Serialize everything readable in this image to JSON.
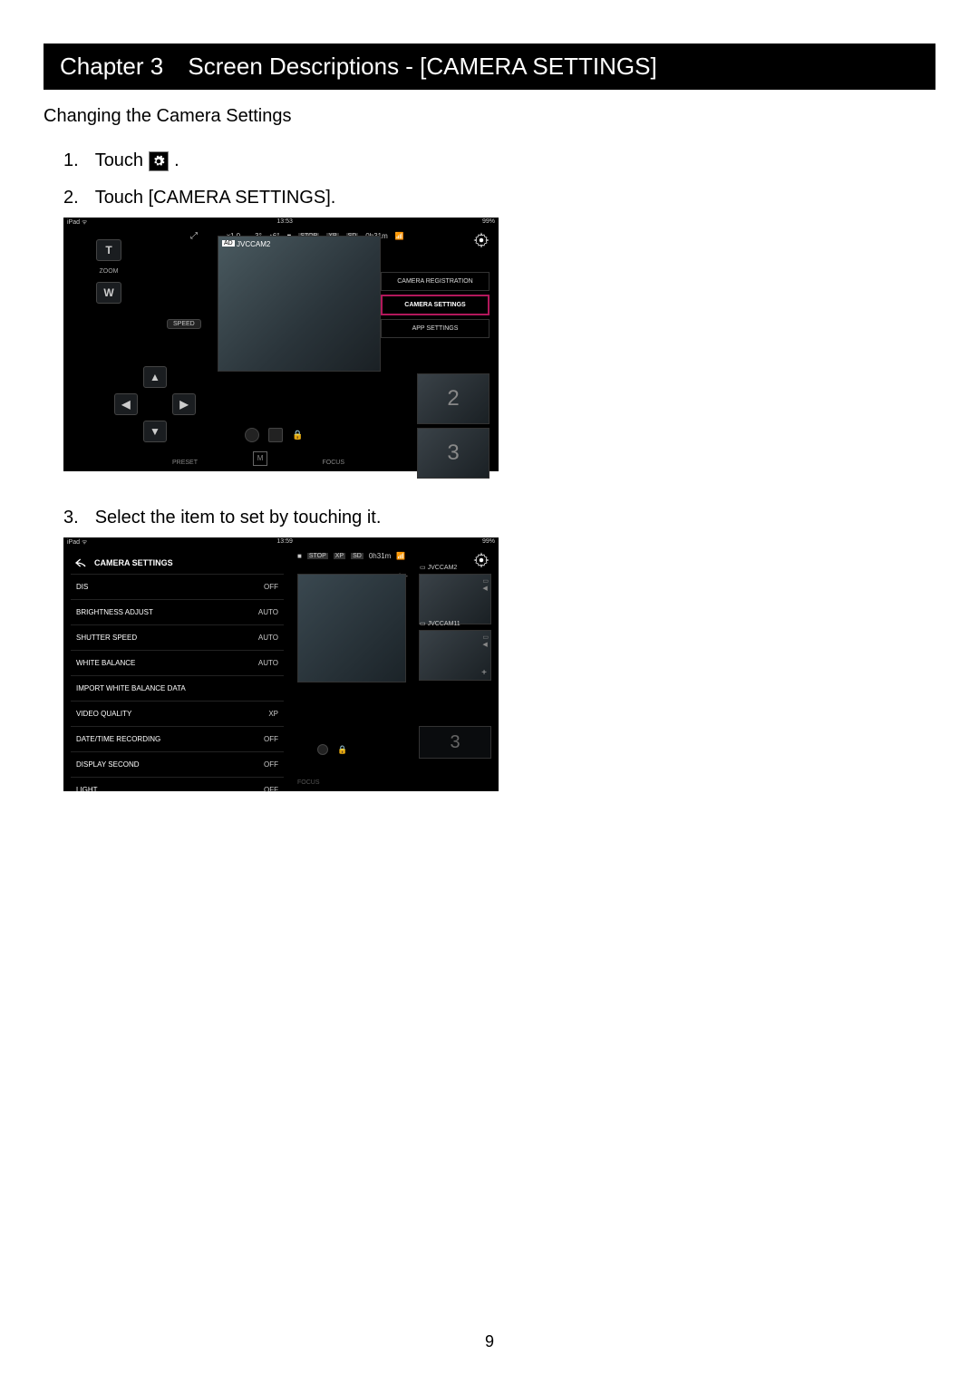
{
  "chapter": {
    "label": "Chapter 3",
    "title": "Screen Descriptions - [CAMERA SETTINGS]"
  },
  "subheading": "Changing the Camera Settings",
  "steps": {
    "s1_num": "1.",
    "s1_text": "Touch",
    "s1_period": ".",
    "s2_num": "2.",
    "s2_text": "Touch [CAMERA SETTINGS].",
    "s3_num": "3.",
    "s3_text": "Select the item to set by touching it."
  },
  "shot1": {
    "status": {
      "left": "iPad ᯤ",
      "time": "13:53",
      "batt": "99%"
    },
    "top": {
      "zoom": "x1.0",
      "arrow_r": "→3°",
      "arrow_u": "↑6°",
      "stop": "STOP",
      "xp": "XP",
      "sd": "SD",
      "dur": "0h31m"
    },
    "cam": {
      "tag": "AD",
      "name": "JVCCAM2"
    },
    "zoomcol": {
      "t": "T",
      "w": "W",
      "zoom": "ZOOM"
    },
    "speed": "SPEED",
    "menu": {
      "reg": "CAMERA REGISTRATION",
      "settings": "CAMERA SETTINGS",
      "app": "APP SETTINGS"
    },
    "tiles": {
      "t2": "2",
      "t3": "3"
    },
    "bottom": {
      "preset": "PRESET",
      "focus": "FOCUS"
    }
  },
  "shot2": {
    "status": {
      "left": "iPad ᯤ",
      "time": "13:59",
      "batt": "99%"
    },
    "top": {
      "stop": "STOP",
      "xp": "XP",
      "sd": "SD",
      "dur": "0h31m"
    },
    "panel_title": "CAMERA SETTINGS",
    "rows": [
      {
        "label": "DIS",
        "val": "OFF"
      },
      {
        "label": "BRIGHTNESS ADJUST",
        "val": "AUTO"
      },
      {
        "label": "SHUTTER SPEED",
        "val": "AUTO"
      },
      {
        "label": "WHITE BALANCE",
        "val": "AUTO"
      },
      {
        "label": "IMPORT WHITE BALANCE DATA",
        "val": ""
      },
      {
        "label": "VIDEO QUALITY",
        "val": "XP"
      },
      {
        "label": "DATE/TIME RECORDING",
        "val": "OFF"
      },
      {
        "label": "DISPLAY SECOND",
        "val": "OFF"
      },
      {
        "label": "LIGHT",
        "val": "OFF"
      }
    ],
    "thumbs": {
      "c1": "JVCCAM2",
      "c2": "JVCCAM11"
    },
    "cv2_icons": "▭ ◀ | +",
    "tile3": "3",
    "focus": "FOCUS"
  },
  "page_number": "9"
}
